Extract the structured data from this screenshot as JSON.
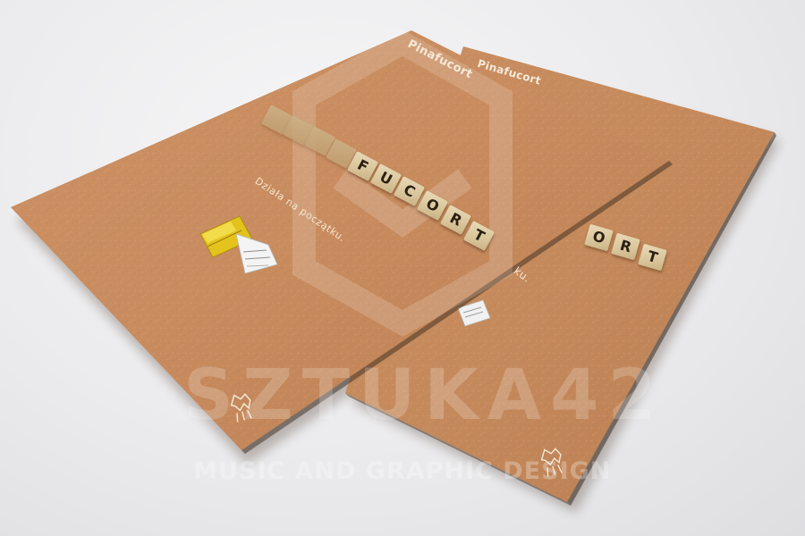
{
  "flyer_front": {
    "brand": "Pinafucort",
    "tagline": "Działa na początku.",
    "word_tiles": [
      "F",
      "U",
      "C",
      "O",
      "R",
      "T"
    ],
    "logo_icon": "horse-icon",
    "product_icon": "ointment-package-icon"
  },
  "flyer_back": {
    "brand": "Pinafucort",
    "tagline_fragment": "ku.",
    "word_tiles": [
      "O",
      "R",
      "T"
    ],
    "logo_icon": "horse-icon",
    "product_icon": "ointment-package-icon"
  },
  "watermark": {
    "name": "SZTUKA42",
    "subtitle": "MUSIC AND GRAPHIC DESIGN",
    "logo_icon": "hexagon-letter-icon"
  },
  "colors": {
    "background": "#ececee",
    "flyer": "#c58a5e",
    "tile": "#dcc9a0",
    "tile_text": "#2a2014",
    "product_yellow": "#e3c31c"
  }
}
